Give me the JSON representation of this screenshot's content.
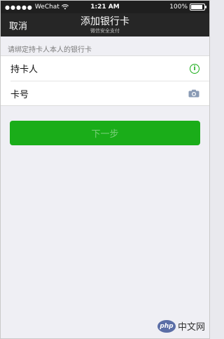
{
  "status_bar": {
    "carrier": "WeChat",
    "time": "1:21 AM",
    "battery_text": "100%",
    "battery_level": 1.0,
    "signal_dots": "●●●●●",
    "wifi_icon": "wifi-icon"
  },
  "nav": {
    "back_label": "取消",
    "title": "添加银行卡",
    "subtitle": "微信安全支付"
  },
  "hint_text": "请绑定持卡人本人的银行卡",
  "form": {
    "rows": [
      {
        "label": "持卡人",
        "icon": "info-icon"
      },
      {
        "label": "卡号",
        "icon": "camera-icon"
      }
    ]
  },
  "next_button": {
    "label": "下一步"
  },
  "watermark": {
    "badge": "php",
    "text": "中文网"
  },
  "colors": {
    "accent": "#1aad19",
    "nav_bg": "#262626",
    "page_bg": "#efeff4"
  }
}
